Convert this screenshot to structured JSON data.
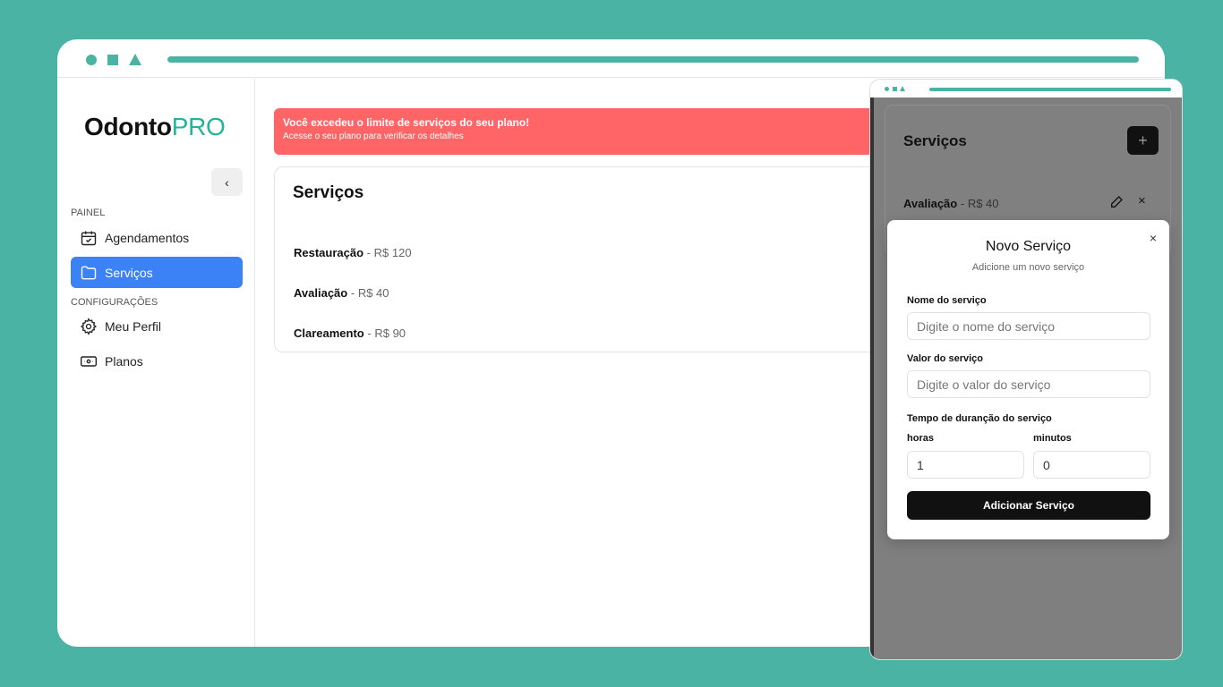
{
  "brand": {
    "name_part1": "Odonto",
    "name_part2": "PRO"
  },
  "sidebar": {
    "collapse_glyph": "‹",
    "section_panel": "PAINEL",
    "section_config": "CONFIGURAÇÕES",
    "items": [
      {
        "label": "Agendamentos",
        "icon": "calendar-check-icon"
      },
      {
        "label": "Serviços",
        "icon": "folder-icon",
        "active": true
      },
      {
        "label": "Meu Perfil",
        "icon": "gear-icon"
      },
      {
        "label": "Planos",
        "icon": "banknote-icon"
      }
    ]
  },
  "alert": {
    "title": "Você excedeu o limite de serviços do seu plano!",
    "subtitle": "Acesse o seu plano para verificar os detalhes"
  },
  "services_card": {
    "title": "Serviços",
    "separator": "-",
    "items": [
      {
        "name": "Restauração",
        "price": "R$ 120"
      },
      {
        "name": "Avaliação",
        "price": "R$ 40"
      },
      {
        "name": "Clareamento",
        "price": "R$ 90"
      }
    ]
  },
  "overlay": {
    "title": "Serviços",
    "add_glyph": "+",
    "item": {
      "name": "Avaliação",
      "separator": "-",
      "price": "R$ 40"
    },
    "delete_glyph": "×"
  },
  "dialog": {
    "title": "Novo Serviço",
    "description": "Adicione um novo serviço",
    "close_glyph": "×",
    "name_label": "Nome do serviço",
    "name_placeholder": "Digite o nome do serviço",
    "value_label": "Valor do serviço",
    "value_placeholder": "Digite o valor do serviço",
    "duration_label": "Tempo de duranção do serviço",
    "hours_label": "horas",
    "hours_value": "1",
    "minutes_label": "minutos",
    "minutes_value": "0",
    "submit_label": "Adicionar Serviço"
  },
  "colors": {
    "background": "#4AB3A3",
    "accent": "#27B29C",
    "active_nav": "#3B82F6",
    "alert": "#FF6467"
  }
}
